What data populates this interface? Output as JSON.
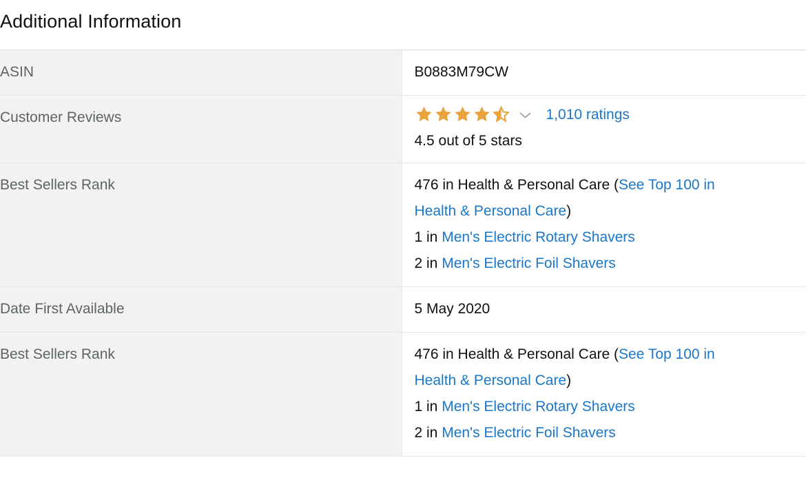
{
  "section": {
    "title": "Additional Information",
    "title_visible_fragment": "onal Information"
  },
  "colors": {
    "link": "#1a77c9",
    "star": "#e8a33d",
    "label_text": "#5e6464",
    "value_text": "#0f1111",
    "row_label_bg": "#f2f2f2",
    "row_value_bg": "#ffffff",
    "rule": "#e7e7e7"
  },
  "table": {
    "rows": [
      {
        "label": "ASIN",
        "type": "text",
        "value": "B0883M79CW"
      },
      {
        "label": "Customer Reviews",
        "type": "rating",
        "rating": {
          "stars_filled": 4,
          "stars_half": 1,
          "stars_total": 5,
          "rating_value": "4.5",
          "summary": "4.5 out of 5 stars",
          "ratings_count_label": "1,010 ratings",
          "dropdown_icon": "chevron-down-icon"
        }
      },
      {
        "label": "Best Sellers Rank",
        "type": "rank",
        "rank_lines": [
          {
            "prefix": "476 in Health & Personal Care (",
            "link": "See Top 100 in",
            "suffix": ""
          },
          {
            "prefix": "",
            "link": "Health & Personal Care",
            "suffix": ")"
          },
          {
            "prefix": "1 in ",
            "link": "Men's Electric Rotary Shavers",
            "suffix": ""
          },
          {
            "prefix": "2 in ",
            "link": "Men's Electric Foil Shavers",
            "suffix": ""
          }
        ]
      },
      {
        "label": "Date First Available",
        "type": "text",
        "value": "5 May 2020"
      },
      {
        "label": "Best Sellers Rank",
        "type": "rank",
        "rank_lines": [
          {
            "prefix": "476 in Health & Personal Care (",
            "link": "See Top 100 in",
            "suffix": ""
          },
          {
            "prefix": "",
            "link": "Health & Personal Care",
            "suffix": ")"
          },
          {
            "prefix": "1 in ",
            "link": "Men's Electric Rotary Shavers",
            "suffix": ""
          },
          {
            "prefix": "2 in ",
            "link": "Men's Electric Foil Shavers",
            "suffix": ""
          }
        ]
      }
    ]
  }
}
